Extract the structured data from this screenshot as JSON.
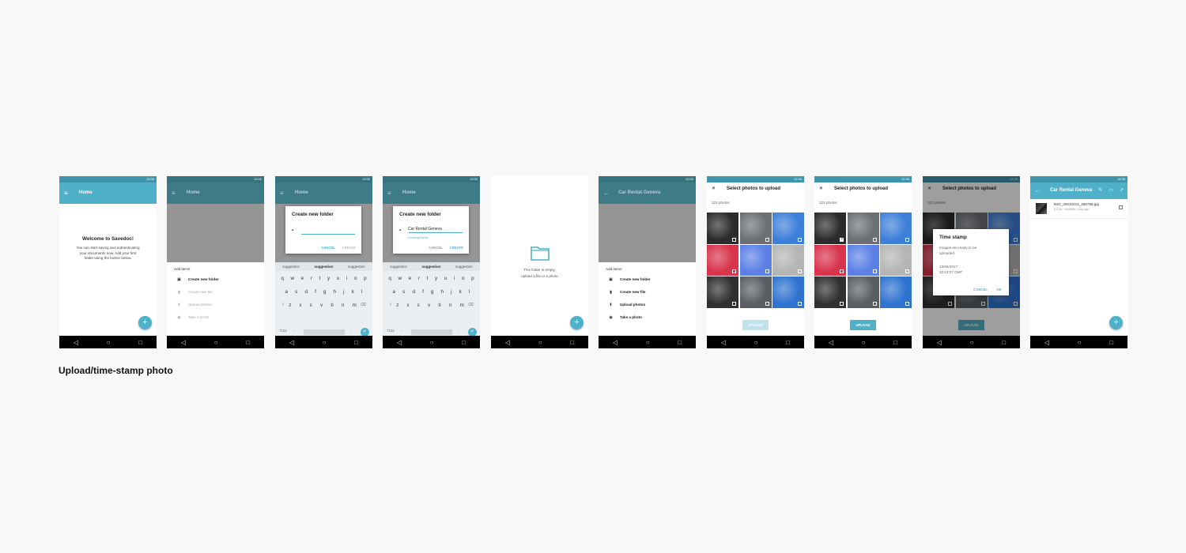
{
  "colors": {
    "accent": "#4fb0c9",
    "statusbar": "#3f96ac",
    "background": "#f8f8f8"
  },
  "status": {
    "time": "12:06",
    "time_alt": "12:00",
    "time_photos": "12:36"
  },
  "nav": {
    "back": "◁",
    "home": "○",
    "recents": "□"
  },
  "screen1": {
    "title": "Home",
    "menu_icon": "menu-icon",
    "welcome": "Welcome to Savedoc!",
    "intro_lines": [
      "You can start saving and authenticating",
      "your documents now. Add your first",
      "folder using the button below."
    ],
    "fab": "+"
  },
  "sheet": {
    "heading": "Add items",
    "items": [
      {
        "label": "Create new folder",
        "icon": "folder-add-icon",
        "glyph": "▣"
      },
      {
        "label": "Create new file",
        "icon": "file-icon",
        "glyph": "▮"
      },
      {
        "label": "Upload photos",
        "icon": "upload-icon",
        "glyph": "⬆"
      },
      {
        "label": "Take a photo",
        "icon": "camera-icon",
        "glyph": "◉"
      }
    ]
  },
  "dialog_folder": {
    "title": "Create new folder",
    "value": "Car Rental Geneva",
    "hint": "Existing folder",
    "cancel": "CANCEL",
    "create": "CREATE"
  },
  "keyboard": {
    "suggestions": [
      "suggestion",
      "suggestion",
      "suggestion"
    ],
    "row1": [
      "q",
      "w",
      "e",
      "r",
      "t",
      "y",
      "u",
      "i",
      "o",
      "p"
    ],
    "row2": [
      "a",
      "s",
      "d",
      "f",
      "g",
      "h",
      "j",
      "k",
      "l"
    ],
    "row3": [
      "z",
      "x",
      "c",
      "v",
      "b",
      "n",
      "m"
    ],
    "num_key": "?123",
    "comma": ",",
    "period": ".",
    "enter": "↵",
    "shift": "⇧",
    "backspace": "⌫"
  },
  "empty_folder": {
    "lines": [
      "This folder is empty,",
      "upload a file or a photo"
    ]
  },
  "folder_screen": {
    "title": "Car Rental Geneva",
    "back_icon": "arrow-back-icon"
  },
  "photos": {
    "title": "Select photos to upload",
    "count": "123 photos",
    "upload": "UPLOAD",
    "close": "✕",
    "selected": [
      true,
      false,
      false,
      false,
      false,
      false,
      false,
      false,
      false
    ],
    "tile_colors": [
      "#2b2b2b",
      "#6c7075",
      "#3d7fd8",
      "#d9344c",
      "#5c80e6",
      "#b5b5b5",
      "#303030",
      "#5a5e63",
      "#2f73d0"
    ]
  },
  "timestamp_dialog": {
    "title": "Time stamp",
    "message": "Images are ready to be uploaded.",
    "date": "13/05/2017",
    "time": "10:12:07 GMT",
    "cancel": "CANCEL",
    "ok": "OK"
  },
  "final": {
    "title": "Car Rental Geneva",
    "file_name": "IMG_20010418_456789.jpg",
    "file_meta": "5.0 kb, modified 1 day ago",
    "actions": [
      "✎",
      "▭",
      "↗"
    ]
  },
  "caption": "Upload/time-stamp photo"
}
